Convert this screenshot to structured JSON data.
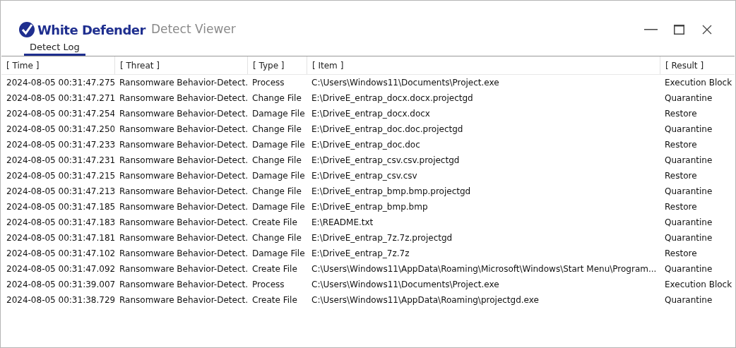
{
  "window": {
    "brand": "White Defender",
    "title": "Detect Viewer"
  },
  "tabs": [
    {
      "label": "Detect Log",
      "selected": true
    }
  ],
  "table": {
    "columns": [
      "[ Time ]",
      "[ Threat ]",
      "[ Type ]",
      "[ Item ]",
      "[ Result ]"
    ],
    "rows": [
      [
        "2024-08-05 00:31:47.275",
        "Ransomware Behavior-Detect.",
        "Process",
        "C:\\Users\\Windows11\\Documents\\Project.exe",
        "Execution Block"
      ],
      [
        "2024-08-05 00:31:47.271",
        "Ransomware Behavior-Detect.",
        "Change File",
        "E:\\DriveE_entrap_docx.docx.projectgd",
        "Quarantine"
      ],
      [
        "2024-08-05 00:31:47.254",
        "Ransomware Behavior-Detect.",
        "Damage File",
        "E:\\DriveE_entrap_docx.docx",
        "Restore"
      ],
      [
        "2024-08-05 00:31:47.250",
        "Ransomware Behavior-Detect.",
        "Change File",
        "E:\\DriveE_entrap_doc.doc.projectgd",
        "Quarantine"
      ],
      [
        "2024-08-05 00:31:47.233",
        "Ransomware Behavior-Detect.",
        "Damage File",
        "E:\\DriveE_entrap_doc.doc",
        "Restore"
      ],
      [
        "2024-08-05 00:31:47.231",
        "Ransomware Behavior-Detect.",
        "Change File",
        "E:\\DriveE_entrap_csv.csv.projectgd",
        "Quarantine"
      ],
      [
        "2024-08-05 00:31:47.215",
        "Ransomware Behavior-Detect.",
        "Damage File",
        "E:\\DriveE_entrap_csv.csv",
        "Restore"
      ],
      [
        "2024-08-05 00:31:47.213",
        "Ransomware Behavior-Detect.",
        "Change File",
        "E:\\DriveE_entrap_bmp.bmp.projectgd",
        "Quarantine"
      ],
      [
        "2024-08-05 00:31:47.185",
        "Ransomware Behavior-Detect.",
        "Damage File",
        "E:\\DriveE_entrap_bmp.bmp",
        "Restore"
      ],
      [
        "2024-08-05 00:31:47.183",
        "Ransomware Behavior-Detect.",
        "Create File",
        "E:\\README.txt",
        "Quarantine"
      ],
      [
        "2024-08-05 00:31:47.181",
        "Ransomware Behavior-Detect.",
        "Change File",
        "E:\\DriveE_entrap_7z.7z.projectgd",
        "Quarantine"
      ],
      [
        "2024-08-05 00:31:47.102",
        "Ransomware Behavior-Detect.",
        "Damage File",
        "E:\\DriveE_entrap_7z.7z",
        "Restore"
      ],
      [
        "2024-08-05 00:31:47.092",
        "Ransomware Behavior-Detect.",
        "Create File",
        "C:\\Users\\Windows11\\AppData\\Roaming\\Microsoft\\Windows\\Start Menu\\Program...",
        "Quarantine"
      ],
      [
        "2024-08-05 00:31:39.007",
        "Ransomware Behavior-Detect.",
        "Process",
        "C:\\Users\\Windows11\\Documents\\Project.exe",
        "Execution Block"
      ],
      [
        "2024-08-05 00:31:38.729",
        "Ransomware Behavior-Detect.",
        "Create File",
        "C:\\Users\\Windows11\\AppData\\Roaming\\projectgd.exe",
        "Quarantine"
      ]
    ]
  }
}
